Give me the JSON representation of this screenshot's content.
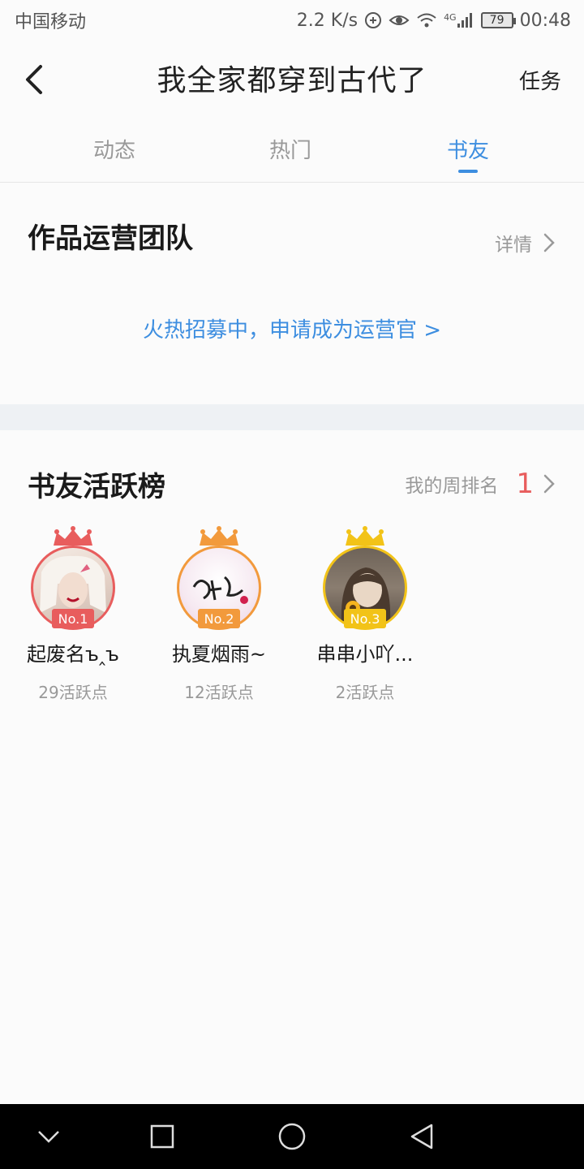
{
  "status_bar": {
    "carrier": "中国移动",
    "speed": "2.2 K/s",
    "network": "4G",
    "battery": "79",
    "time": "00:48"
  },
  "header": {
    "title": "我全家都穿到古代了",
    "task_label": "任务"
  },
  "tabs": [
    {
      "label": "动态",
      "active": false
    },
    {
      "label": "热门",
      "active": false
    },
    {
      "label": "书友",
      "active": true
    }
  ],
  "ops_team": {
    "title": "作品运营团队",
    "detail_label": "详情",
    "recruit_text": "火热招募中，申请成为运营官 >"
  },
  "leaderboard": {
    "title": "书友活跃榜",
    "my_rank_label": "我的周排名",
    "my_rank_value": "1",
    "users": [
      {
        "name": "起废名ъ‸ъ",
        "badge": "No.1",
        "points": "29活跃点"
      },
      {
        "name": "执夏烟雨~",
        "badge": "No.2",
        "points": "12活跃点"
      },
      {
        "name": "串串小吖...",
        "badge": "No.3",
        "points": "2活跃点"
      }
    ]
  },
  "colors": {
    "accent": "#3d8ee0",
    "rank1": "#e85d5d",
    "rank2": "#f29a3c",
    "rank3": "#f2c318",
    "band": "#eef1f4"
  }
}
